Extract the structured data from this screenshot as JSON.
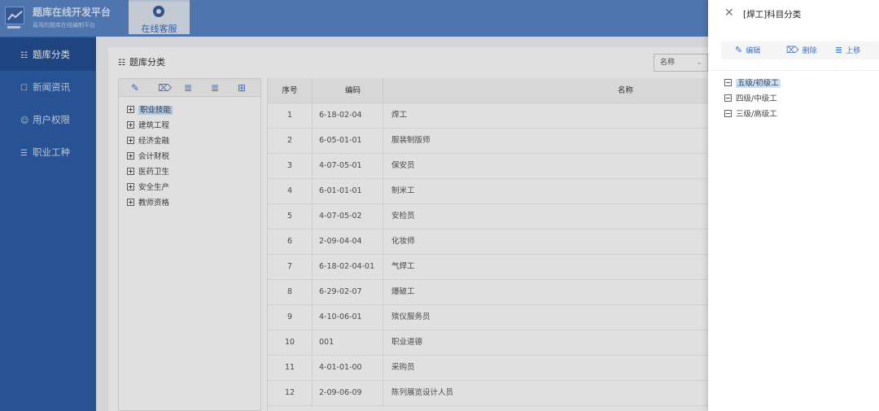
{
  "header": {
    "brand_title": "题库在线开发平台",
    "brand_subtitle": "易用的题库在线编制平台",
    "online_tab": "在线客服"
  },
  "sidebar": {
    "items": [
      {
        "label": "题库分类",
        "icon": "tree-icon",
        "active": true
      },
      {
        "label": "新闻资讯",
        "icon": "news-icon",
        "active": false
      },
      {
        "label": "用户权限",
        "icon": "user-icon",
        "active": false
      },
      {
        "label": "职业工种",
        "icon": "list-icon",
        "active": false
      }
    ]
  },
  "main": {
    "title": "题库分类",
    "filter_select": "名称",
    "tree_toolbar_icons": [
      "edit-icon",
      "delete-icon",
      "move-up-icon",
      "move-down-icon",
      "add-icon"
    ],
    "tree": [
      "职业技能",
      "建筑工程",
      "经济金融",
      "会计财税",
      "医药卫生",
      "安全生产",
      "教师资格"
    ],
    "selected_tree": "职业技能",
    "table": {
      "columns": [
        "序号",
        "编码",
        "名称"
      ],
      "rows": [
        {
          "idx": "1",
          "code": "6-18-02-04",
          "name": "焊工"
        },
        {
          "idx": "2",
          "code": "6-05-01-01",
          "name": "服装制版师"
        },
        {
          "idx": "3",
          "code": "4-07-05-01",
          "name": "保安员"
        },
        {
          "idx": "4",
          "code": "6-01-01-01",
          "name": "制米工"
        },
        {
          "idx": "5",
          "code": "4-07-05-02",
          "name": "安检员"
        },
        {
          "idx": "6",
          "code": "2-09-04-04",
          "name": "化妆师"
        },
        {
          "idx": "7",
          "code": "6-18-02-04-01",
          "name": "气焊工"
        },
        {
          "idx": "8",
          "code": "6-29-02-07",
          "name": "爆破工"
        },
        {
          "idx": "9",
          "code": "4-10-06-01",
          "name": "殡仪服务员"
        },
        {
          "idx": "10",
          "code": "001",
          "name": "职业道德"
        },
        {
          "idx": "11",
          "code": "4-01-01-00",
          "name": "采购员"
        },
        {
          "idx": "12",
          "code": "2-09-06-09",
          "name": "陈列展览设计人员"
        }
      ]
    }
  },
  "drawer": {
    "title": "[焊工]科目分类",
    "buttons": [
      {
        "label": "编辑",
        "icon": "edit-icon"
      },
      {
        "label": "删除",
        "icon": "delete-icon"
      },
      {
        "label": "上移",
        "icon": "move-up-icon"
      }
    ],
    "tree": [
      {
        "label": "五级/初级工",
        "selected": true
      },
      {
        "label": "四级/中级工",
        "selected": false
      },
      {
        "label": "三级/高级工",
        "selected": false
      }
    ]
  },
  "colors": {
    "header_bg": "#5b86c8",
    "sidebar_bg": "#2d5ea8",
    "accent": "#3b73c9",
    "selection": "#c7e1ff"
  }
}
